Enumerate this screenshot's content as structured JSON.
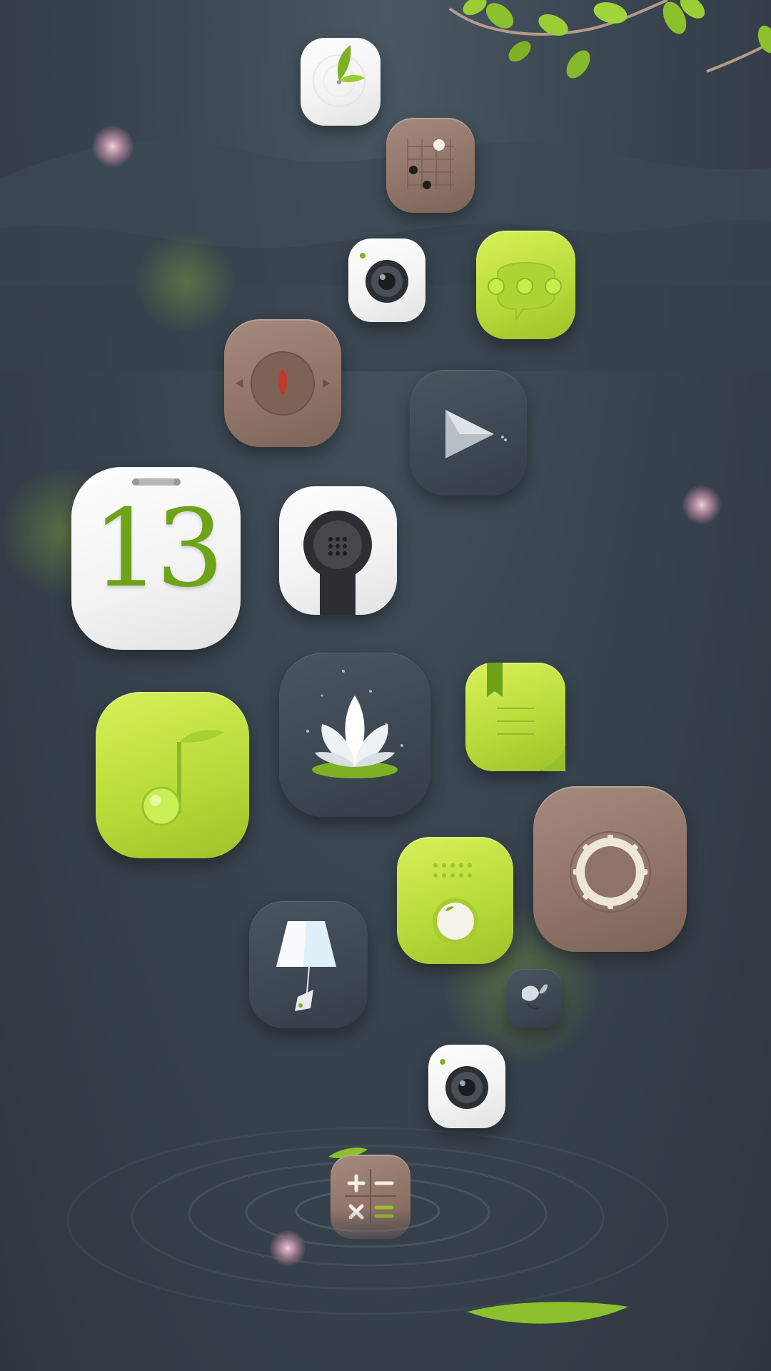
{
  "theme": {
    "background": "#353e48",
    "accent_green": "#b8dc3a",
    "accent_brown": "#8f7367",
    "accent_white": "#f4f4f4",
    "accent_slate": "#3f4955"
  },
  "calendar": {
    "day": "13"
  },
  "icons": [
    {
      "name": "tea-leaf-icon",
      "style": "white"
    },
    {
      "name": "go-board-icon",
      "style": "brown"
    },
    {
      "name": "camera-icon",
      "style": "white"
    },
    {
      "name": "messages-icon",
      "style": "green"
    },
    {
      "name": "compass-icon",
      "style": "brown"
    },
    {
      "name": "video-player-icon",
      "style": "slate"
    },
    {
      "name": "calendar-icon",
      "style": "white"
    },
    {
      "name": "phone-icon",
      "style": "white"
    },
    {
      "name": "music-note-icon",
      "style": "green"
    },
    {
      "name": "lotus-icon",
      "style": "slate"
    },
    {
      "name": "notes-icon",
      "style": "green"
    },
    {
      "name": "safe-dial-icon",
      "style": "brown"
    },
    {
      "name": "radio-icon",
      "style": "green"
    },
    {
      "name": "lamp-icon",
      "style": "slate"
    },
    {
      "name": "butterfly-icon",
      "style": "slate"
    },
    {
      "name": "camera-secondary-icon",
      "style": "white"
    },
    {
      "name": "calculator-icon",
      "style": "brown"
    }
  ]
}
